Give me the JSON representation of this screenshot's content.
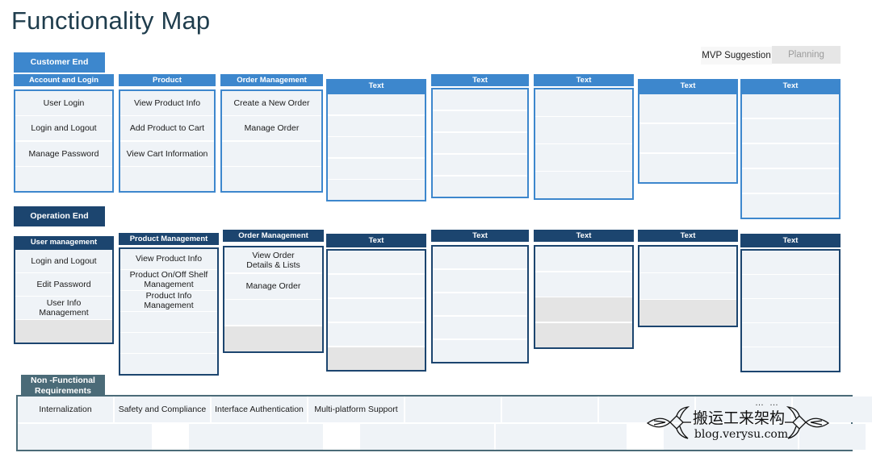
{
  "page": {
    "title": "Functionality Map",
    "accent_blue": "#3d87cd",
    "accent_navy": "#1c456f",
    "accent_teal": "#4b6b78",
    "cell_light": "#eff3f7",
    "cell_grey": "#e4e4e4"
  },
  "legend": {
    "mvp_label": "MVP Suggestion",
    "planning_label": "Planning"
  },
  "sections": {
    "customer_end": "Customer End",
    "operation_end": "Operation End",
    "non_functional": "Non -Functional\nRequirements"
  },
  "customer_cards": [
    {
      "header": "Account and Login",
      "rows": [
        "User Login",
        "Login and Logout",
        "Manage Password",
        ""
      ],
      "fills": [
        "light",
        "light",
        "light",
        "light"
      ]
    },
    {
      "header": "Product",
      "rows": [
        "View Product Info",
        "Add Product to Cart",
        "View Cart Information",
        ""
      ],
      "fills": [
        "light",
        "light",
        "light",
        "light"
      ]
    },
    {
      "header": "Order Management",
      "rows": [
        "Create a New Order",
        "Manage Order",
        "",
        ""
      ],
      "fills": [
        "light",
        "light",
        "light",
        "light"
      ]
    },
    {
      "header": "Text",
      "rows": [
        "",
        "",
        "",
        "",
        ""
      ],
      "fills": [
        "light",
        "light",
        "light",
        "light",
        "light"
      ]
    },
    {
      "header": "Text",
      "rows": [
        "",
        "",
        "",
        "",
        ""
      ],
      "fills": [
        "light",
        "light",
        "light",
        "light",
        "light"
      ]
    },
    {
      "header": "Text",
      "rows": [
        "",
        "",
        "",
        ""
      ],
      "fills": [
        "light",
        "light",
        "light",
        "light"
      ]
    },
    {
      "header": "Text",
      "rows": [
        "",
        "",
        ""
      ],
      "fills": [
        "light",
        "light",
        "light"
      ]
    },
    {
      "header": "Text",
      "rows": [
        "",
        "",
        "",
        "",
        ""
      ],
      "fills": [
        "light",
        "light",
        "light",
        "light",
        "light"
      ]
    }
  ],
  "operation_cards": [
    {
      "header": "User management",
      "rows": [
        "Login and Logout",
        "Edit Password",
        "User Info\nManagement",
        ""
      ],
      "fills": [
        "light",
        "light",
        "light",
        "grey"
      ]
    },
    {
      "header": "Product  Management",
      "rows": [
        "View Product Info",
        "Product On/Off Shelf\nManagement",
        "Product Info\nManagement",
        "",
        "",
        ""
      ],
      "fills": [
        "light",
        "light",
        "light",
        "light",
        "light",
        "light"
      ]
    },
    {
      "header": "Order Management",
      "rows": [
        "View Order\nDetails & Lists",
        "Manage Order",
        "",
        ""
      ],
      "fills": [
        "light",
        "light",
        "light",
        "grey"
      ]
    },
    {
      "header": "Text",
      "rows": [
        "",
        "",
        "",
        "",
        ""
      ],
      "fills": [
        "light",
        "light",
        "light",
        "light",
        "grey"
      ]
    },
    {
      "header": "Text",
      "rows": [
        "",
        "",
        "",
        "",
        ""
      ],
      "fills": [
        "light",
        "light",
        "light",
        "light",
        "light"
      ]
    },
    {
      "header": "Text",
      "rows": [
        "",
        "",
        "",
        ""
      ],
      "fills": [
        "light",
        "light",
        "grey",
        "grey"
      ]
    },
    {
      "header": "Text",
      "rows": [
        "",
        "",
        ""
      ],
      "fills": [
        "light",
        "light",
        "grey"
      ]
    },
    {
      "header": "Text",
      "rows": [
        "",
        "",
        "",
        "",
        ""
      ],
      "fills": [
        "light",
        "light",
        "light",
        "light",
        "light"
      ]
    }
  ],
  "non_functional_rows": [
    [
      {
        "label": "Internalization",
        "filled": true
      },
      {
        "label": "Safety and Compliance",
        "filled": true
      },
      {
        "label": "Interface Authentication",
        "filled": true
      },
      {
        "label": "Multi-platform Support",
        "filled": true
      },
      {
        "label": "",
        "filled": true
      },
      {
        "label": "",
        "filled": true
      },
      {
        "label": "",
        "filled": true
      },
      {
        "label": "",
        "filled": true
      },
      {
        "label": "",
        "filled": true
      }
    ],
    [
      {
        "label": "",
        "filled": true
      },
      {
        "label": "",
        "filled": false
      },
      {
        "label": "",
        "filled": true
      },
      {
        "label": "",
        "filled": false
      },
      {
        "label": "",
        "filled": true
      },
      {
        "label": "",
        "filled": true
      },
      {
        "label": "",
        "filled": false
      },
      {
        "label": "",
        "filled": true
      },
      {
        "label": "",
        "filled": true
      }
    ]
  ],
  "watermark": {
    "text": "搬运工来架构",
    "url": "blog.verysu.com",
    "dots": "… …"
  }
}
